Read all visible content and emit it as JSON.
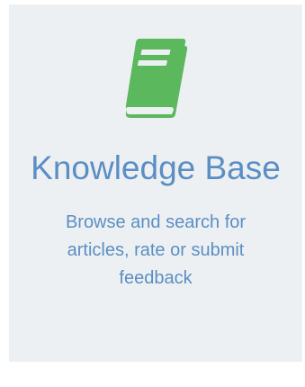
{
  "card": {
    "icon": "book-icon",
    "icon_color": "#5cb85c",
    "title": "Knowledge Base",
    "description": "Browse and search for articles, rate or submit feedback",
    "text_color": "#5b8ec4"
  }
}
